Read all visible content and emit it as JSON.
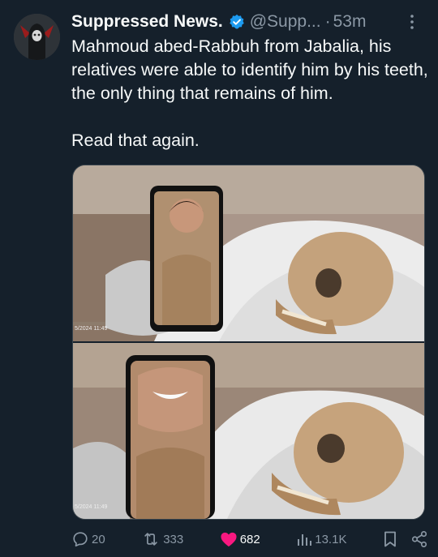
{
  "author": {
    "name": "Suppressed News.",
    "handle": "@Supp...",
    "time": "53m",
    "separator": "·"
  },
  "tweet": {
    "paragraphs": [
      "Mahmoud abed-Rabbuh from Jabalia, his relatives were able to identify him by his teeth, the only thing that remains of him.",
      "Read that again."
    ]
  },
  "media": {
    "photos": [
      {
        "timestamp": "5/2024 11:49"
      },
      {
        "timestamp": "5/2024 11:49"
      }
    ]
  },
  "actions": {
    "replies": "20",
    "reposts": "333",
    "likes": "682",
    "views": "13.1K"
  },
  "colors": {
    "background": "#15202b",
    "text": "#f7f9f9",
    "muted": "#8b98a5",
    "verified": "#1d9bf0",
    "like": "#f91880"
  }
}
